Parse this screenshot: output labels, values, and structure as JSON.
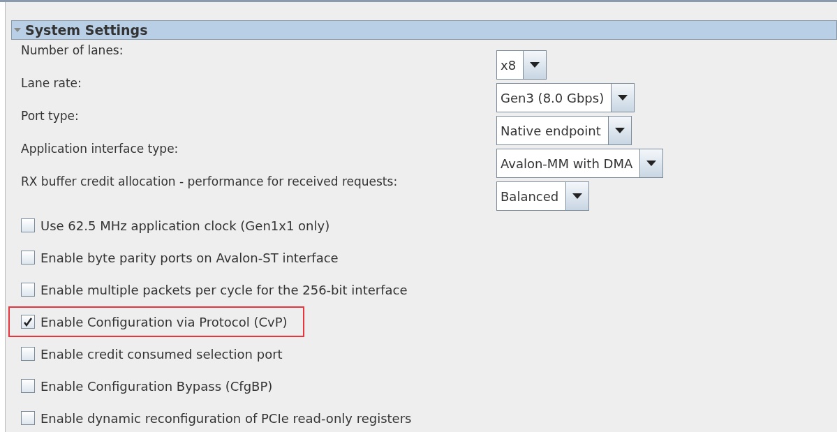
{
  "section": {
    "title": "System Settings",
    "expanded": true
  },
  "fields": [
    {
      "label": "Number of lanes:",
      "value": "x8"
    },
    {
      "label": "Lane rate:",
      "value": "Gen3 (8.0 Gbps)"
    },
    {
      "label": "Port type:",
      "value": "Native endpoint"
    },
    {
      "label": "Application interface type:",
      "value": "Avalon-MM with DMA"
    },
    {
      "label": "RX buffer credit allocation - performance for received requests:",
      "value": "Balanced"
    }
  ],
  "options": [
    {
      "label": "Use 62.5 MHz application clock (Gen1x1 only)",
      "checked": false,
      "highlighted": false
    },
    {
      "label": "Enable byte parity ports on Avalon-ST interface",
      "checked": false,
      "highlighted": false
    },
    {
      "label": "Enable multiple packets per cycle for the 256-bit interface",
      "checked": false,
      "highlighted": false
    },
    {
      "label": "Enable Configuration via Protocol (CvP)",
      "checked": true,
      "highlighted": true
    },
    {
      "label": "Enable credit consumed selection port",
      "checked": false,
      "highlighted": false
    },
    {
      "label": "Enable Configuration Bypass (CfgBP)",
      "checked": false,
      "highlighted": false
    },
    {
      "label": "Enable dynamic reconfiguration of PCIe read-only registers",
      "checked": false,
      "highlighted": false
    }
  ]
}
